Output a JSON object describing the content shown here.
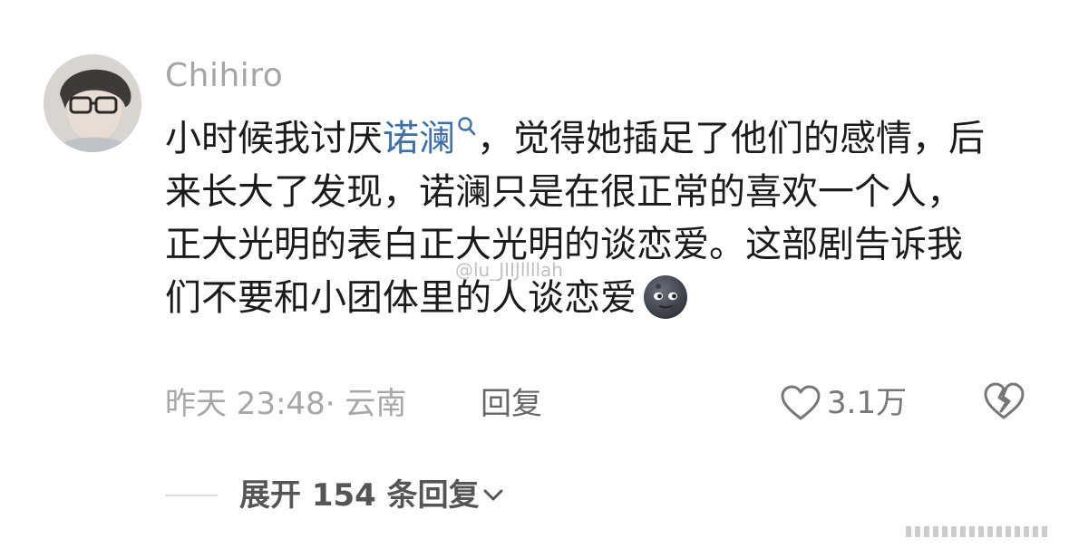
{
  "comment": {
    "username": "Chihiro",
    "text_before_mention": "小时候我讨厌",
    "mention": "诺澜",
    "text_after_mention": "，觉得她插足了他们的感情，后来长大了发现，诺澜只是在很正常的喜欢一个人，正大光明的表白正大光明的谈恋爱。这部剧告诉我们不要和小团体里的人谈恋爱",
    "emoji": "new-moon-face-emoji",
    "timestamp": "昨天 23:48· 云南",
    "reply_label": "回复",
    "like_count": "3.1万"
  },
  "replies": {
    "expand_label": "展开 154 条回复"
  },
  "watermark": "@lu_JIIJllllah",
  "colors": {
    "mention": "#3e6fa8",
    "text": "#1b1b1b",
    "meta": "#a7a7a7"
  }
}
